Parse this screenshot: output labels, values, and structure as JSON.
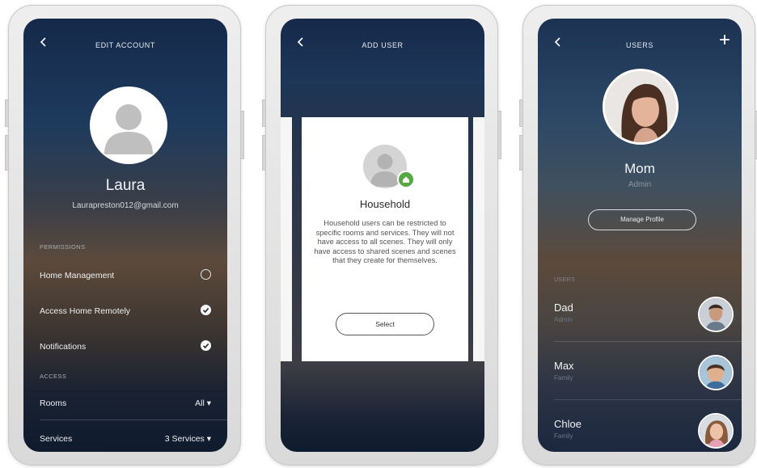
{
  "edit_account": {
    "title": "EDIT ACCOUNT",
    "name": "Laura",
    "email": "Laurapreston012@gmail.com",
    "permissions_header": "PERMISSIONS",
    "permissions": [
      {
        "label": "Home Management",
        "checked": false
      },
      {
        "label": "Access Home Remotely",
        "checked": true
      },
      {
        "label": "Notifications",
        "checked": true
      }
    ],
    "access_header": "ACCESS",
    "access": [
      {
        "label": "Rooms",
        "value": "All ▾"
      },
      {
        "label": "Services",
        "value": "3 Services ▾"
      }
    ]
  },
  "add_user": {
    "title": "ADD USER",
    "card_title": "Household",
    "card_description": "Household users can be restricted to specific rooms and services. They will not have access to all scenes. They will only have access to shared scenes and scenes that they create for themselves.",
    "select_label": "Select"
  },
  "users": {
    "title": "USERS",
    "plus_icon": "+",
    "name": "Mom",
    "role": "Admin",
    "manage_label": "Manage Profile",
    "users_header": "USERS",
    "list": [
      {
        "name": "Dad",
        "role": "Admin"
      },
      {
        "name": "Max",
        "role": "Family"
      },
      {
        "name": "Chloe",
        "role": "Family"
      }
    ]
  },
  "colors": {
    "badge_green": "#56a843",
    "check_fill": "#ffffff"
  }
}
